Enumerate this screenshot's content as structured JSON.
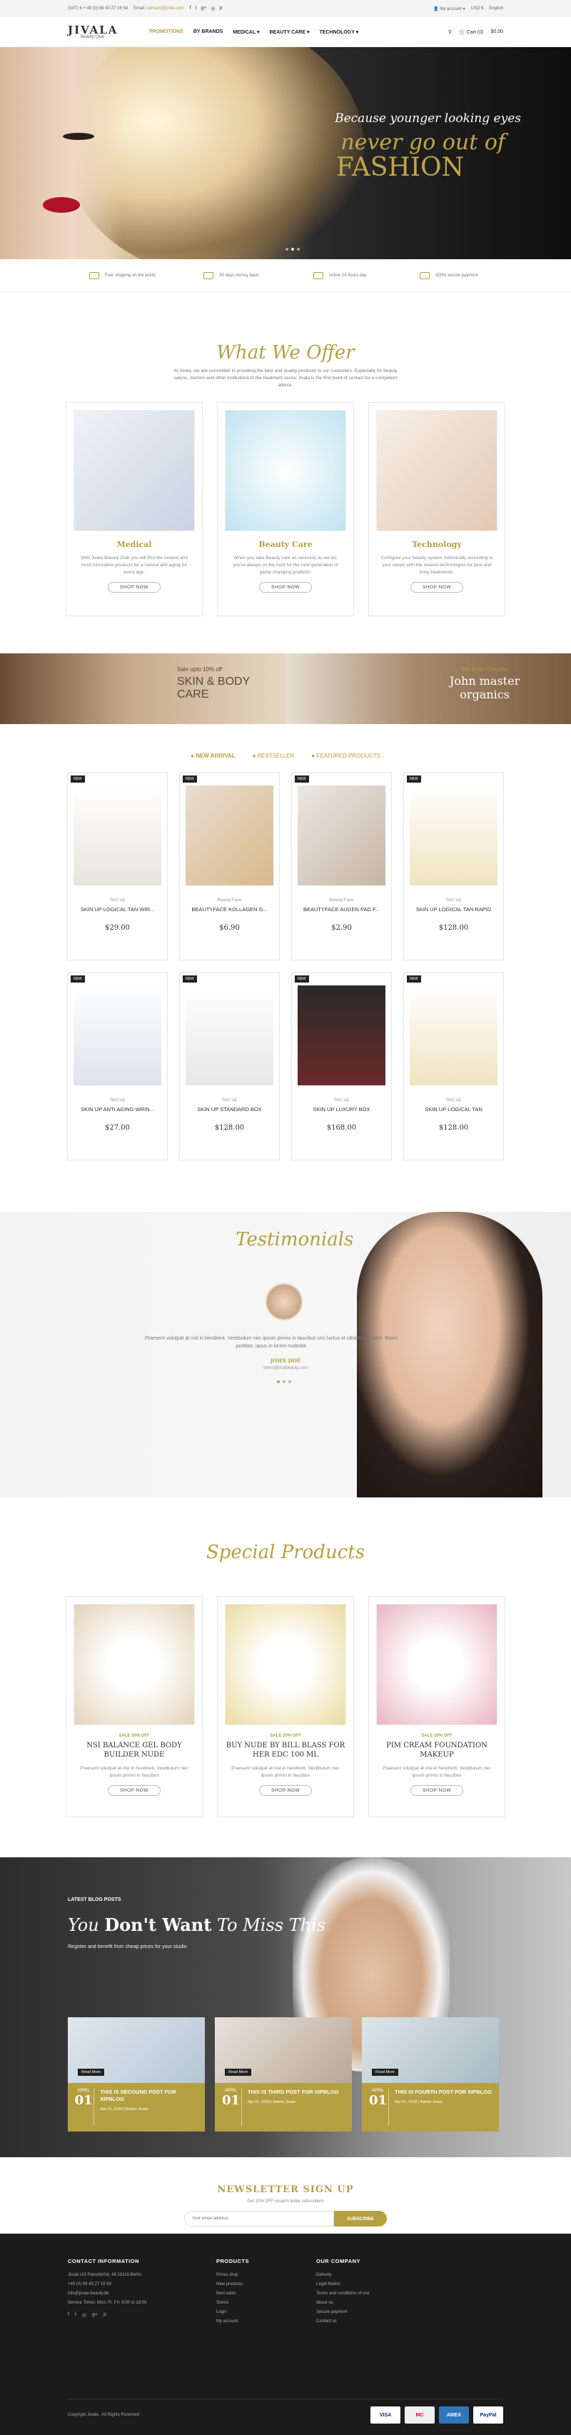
{
  "topbar": {
    "phone": "(VAT) 6 + 49 (0) 89 43 27 16 54",
    "email_label": "Email:",
    "email": "contact@jivala.com",
    "account": "My account",
    "currency": "USD $",
    "language": "English"
  },
  "header": {
    "logo_main": "JIVALA",
    "logo_sub": "Beauty Club",
    "nav": [
      "PROMOTIONS",
      "BY BRANDS",
      "MEDICAL",
      "BEAUTY CARE",
      "TECHNOLOGY"
    ],
    "cart": "Cart (0)",
    "cart_total": "$0.00"
  },
  "hero": {
    "line1": "Because younger looking eyes",
    "line2": "never go out of",
    "line3": "FASHION"
  },
  "features": [
    "Free shipping on the world",
    "30 days money back",
    "online 24 hours day",
    "100% secure payment"
  ],
  "offer": {
    "title": "What We Offer",
    "intro": "At Jivala, we are committed to providing the best and quality products to our customers. Especially for beauty salons, doctors and other institutions in the treatment sector Jivala is the first point of contact for a competent advice.",
    "cards": [
      {
        "title": "Medical",
        "desc": "With Jivala Beauty Club you will find the newest and most innovative products for a natural anti-aging for every age.",
        "button": "SHOP NOW"
      },
      {
        "title": "Beauty Care",
        "desc": "When you take Beauty care as seriously as we do, you're always on the hunt for the next generation of game changing products.",
        "button": "SHOP NOW"
      },
      {
        "title": "Technology",
        "desc": "Configure your beauty system individually according to your needs with the newest technologies for face and body treatments.",
        "button": "SHOP NOW"
      }
    ]
  },
  "banners": {
    "left_small": "Sale upto 10% off",
    "left_big1": "SKIN & BODY",
    "left_big2": "CARE",
    "right_small": "We love Creams",
    "right_big1": "John master",
    "right_big2": "organics"
  },
  "tabs": [
    "NEW ARRIVAL",
    "BESTSELLER",
    "FEATURED PRODUCTS"
  ],
  "products": [
    {
      "badge": "NEW",
      "cat": "Skin Up",
      "name": "SKIN UP LOGICAL TAN WIR...",
      "price": "$29.00"
    },
    {
      "badge": "NEW",
      "cat": "Beauty Face",
      "name": "BEAUTYFACE KOLLAGEN G...",
      "price": "$6.90"
    },
    {
      "badge": "NEW",
      "cat": "Beauty Face",
      "name": "BEAUTYFACE AUGEN PAD F...",
      "price": "$2.90"
    },
    {
      "badge": "NEW",
      "cat": "Skin Up",
      "name": "SKIN UP LOGICAL TAN RAPID",
      "price": "$128.00"
    },
    {
      "badge": "NEW",
      "cat": "Skin Up",
      "name": "SKIN UP ANTI AGING WRIN...",
      "price": "$27.00"
    },
    {
      "badge": "NEW",
      "cat": "Skin Up",
      "name": "SKIN UP STANDARD BOX",
      "price": "$128.00"
    },
    {
      "badge": "NEW",
      "cat": "Skin Up",
      "name": "SKIN UP LUXURY BOX",
      "price": "$168.00"
    },
    {
      "badge": "NEW",
      "cat": "Skin Up",
      "name": "SKIN UP LOGICAL TAN",
      "price": "$128.00"
    }
  ],
  "testimonials": {
    "title": "Testimonials",
    "quote": "Praesent volutpat at nisl in hendrerit. Vestibulum nec ipsum primis in faucibus orci luctus et ultrices posuere. Etiam porttitor, lacus in lorem molestie",
    "name": "JOHN DOE",
    "email": "demo@jivalbeauty.com"
  },
  "special": {
    "title": "Special Products",
    "cards": [
      {
        "sale": "SALE 30% OFF",
        "title": "NSI BALANCE GEL BODY BUILDER NUDE",
        "desc": "Praesent volutpat at nisl in hendrerit. Vestibulum nec ipsum primis in faucibus",
        "button": "SHOP NOW"
      },
      {
        "sale": "SALE 20% OFF",
        "title": "BUY NUDE BY BILL BLASS FOR HER EDC 100 ML",
        "desc": "Praesent volutpat at nisl in hendrerit. Vestibulum nec ipsum primis in faucibus",
        "button": "SHOP NOW"
      },
      {
        "sale": "SALE 20% OFF",
        "title": "PIM CREAM FOUNDATION MAKEUP",
        "desc": "Praesent volutpat at nisl in hendrerit. Vestibulum nec ipsum primis in faucibus",
        "button": "SHOP NOW"
      }
    ]
  },
  "blog": {
    "label": "LATEST BLOG POSTS",
    "h_a": "You",
    "h_b": "Don't Want",
    "h_c": "To Miss This",
    "sub": "Register and benefit from cheap prices for your studio",
    "posts": [
      {
        "month": "APRIL",
        "day": "01",
        "title": "THIS IS SECOUND POST FOR XIPBLOG",
        "meta": "Apr 01, 2018 | Admin Jivala",
        "more": "Read More"
      },
      {
        "month": "APRIL",
        "day": "01",
        "title": "THIS IS THIRD POST FOR XIPBLOG",
        "meta": "Apr 01, 2018 | Admin Jivala",
        "more": "Read More"
      },
      {
        "month": "APRIL",
        "day": "01",
        "title": "THIS IS FOURTH POST FOR XIPBLOG",
        "meta": "Apr 01, 2018 | Admin Jivala",
        "more": "Read More"
      }
    ]
  },
  "newsletter": {
    "title": "NEWSLETTER SIGN UP",
    "sub": "Get 10% OFF coupon today subscribers",
    "placeholder": "Your email address",
    "button": "SUBSCRIBE"
  },
  "footer": {
    "c1_title": "CONTACT INFORMATION",
    "c1": [
      "Jivala UG Pansdorfstr. 46 18119 Berlin",
      "+49 (0) 89 43 27 16 54",
      "info@jivala-beauty.de",
      "Service Times: Mon.-Fr. Fri: 9:00 to 18:00"
    ],
    "c2_title": "PRODUCTS",
    "c2": [
      "Prices drop",
      "New products",
      "Best sales",
      "Stores",
      "Login",
      "My account"
    ],
    "c3_title": "OUR COMPANY",
    "c3": [
      "Delivery",
      "Legal Notice",
      "Terms and conditions of use",
      "About us",
      "Secure payment",
      "Contact us"
    ],
    "copyright": "Copyright Jivala . All Rights Reserved",
    "pay": [
      "VISA",
      "MC",
      "AMEX",
      "PayPal"
    ]
  }
}
